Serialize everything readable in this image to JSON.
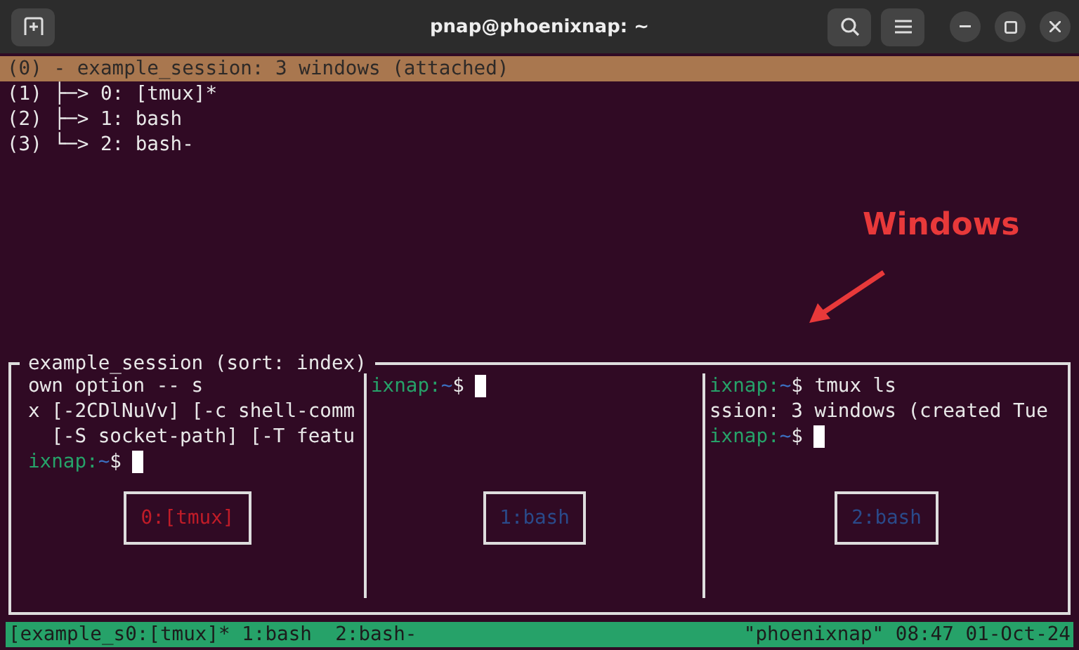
{
  "window": {
    "title": "pnap@phoenixnap: ~"
  },
  "tree": [
    {
      "text": "(0) - example_session: 3 windows (attached)",
      "selected": true
    },
    {
      "text": "(1) ├─> 0: [tmux]*",
      "selected": false
    },
    {
      "text": "(2) ├─> 1: bash",
      "selected": false
    },
    {
      "text": "(3) └─> 2: bash-",
      "selected": false
    }
  ],
  "annotation": {
    "text": "Windows"
  },
  "preview": {
    "title": "example_session (sort: index)",
    "panes": [
      {
        "label": "0:[tmux]",
        "active": true,
        "lines": [
          {
            "kind": "output",
            "text": "own option -- s"
          },
          {
            "kind": "output",
            "text": "x [-2CDlNuVv] [-c shell-comm"
          },
          {
            "kind": "output",
            "text": "  [-S socket-path] [-T featu"
          },
          {
            "kind": "prompt",
            "host": "ixnap:",
            "path": "~",
            "symbol": "$",
            "cursor": true
          }
        ]
      },
      {
        "label": "1:bash",
        "active": false,
        "lines": [
          {
            "kind": "prompt",
            "host": "ixnap:",
            "path": "~",
            "symbol": "$",
            "cursor": true
          }
        ]
      },
      {
        "label": "2:bash",
        "active": false,
        "lines": [
          {
            "kind": "prompt",
            "host": "ixnap:",
            "path": "~",
            "symbol": "$",
            "command": "tmux ls",
            "cursor": false
          },
          {
            "kind": "output",
            "text": "ssion: 3 windows (created Tue"
          },
          {
            "kind": "prompt",
            "host": "ixnap:",
            "path": "~",
            "symbol": "$",
            "cursor": true
          }
        ]
      }
    ]
  },
  "status_bar": {
    "left": "[example_s0:[tmux]* 1:bash  2:bash-",
    "right": "\"phoenixnap\" 08:47 01-Oct-24"
  }
}
